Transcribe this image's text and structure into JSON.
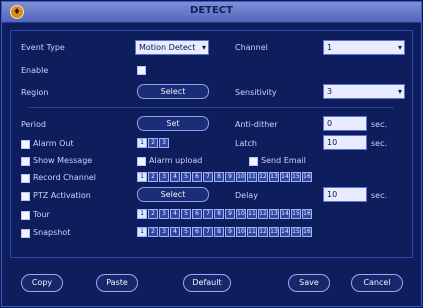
{
  "window": {
    "title": "DETECT"
  },
  "labels": {
    "event_type": "Event Type",
    "enable": "Enable",
    "region": "Region",
    "channel": "Channel",
    "sensitivity": "Sensitivity",
    "period": "Period",
    "anti_dither": "Anti-dither",
    "alarm_out": "Alarm Out",
    "latch": "Latch",
    "show_message": "Show Message",
    "alarm_upload": "Alarm upload",
    "send_email": "Send Email",
    "record_channel": "Record Channel",
    "ptz_activation": "PTZ Activation",
    "delay": "Delay",
    "tour": "Tour",
    "snapshot": "Snapshot",
    "sec": "sec."
  },
  "values": {
    "event_type": "Motion Detect",
    "channel": "1",
    "sensitivity": "3",
    "anti_dither": "0",
    "latch": "10",
    "delay": "10"
  },
  "buttons": {
    "region": "Select",
    "period": "Set",
    "ptz": "Select",
    "copy": "Copy",
    "paste": "Paste",
    "default": "Default",
    "save": "Save",
    "cancel": "Cancel"
  },
  "alarm_out_numbers": [
    "1",
    "2",
    "3"
  ],
  "record_channels": [
    "1",
    "2",
    "3",
    "4",
    "5",
    "6",
    "7",
    "8",
    "9",
    "10",
    "11",
    "12",
    "13",
    "14",
    "15",
    "16"
  ],
  "tour_channels": [
    "1",
    "2",
    "3",
    "4",
    "5",
    "6",
    "7",
    "8",
    "9",
    "10",
    "11",
    "12",
    "13",
    "14",
    "15",
    "16"
  ],
  "snapshot_channels": [
    "1",
    "2",
    "3",
    "4",
    "5",
    "6",
    "7",
    "8",
    "9",
    "10",
    "11",
    "12",
    "13",
    "14",
    "15",
    "16"
  ],
  "colors": {
    "accent": "#5365be",
    "background": "#0e1d5c",
    "field": "#e9ecff"
  }
}
